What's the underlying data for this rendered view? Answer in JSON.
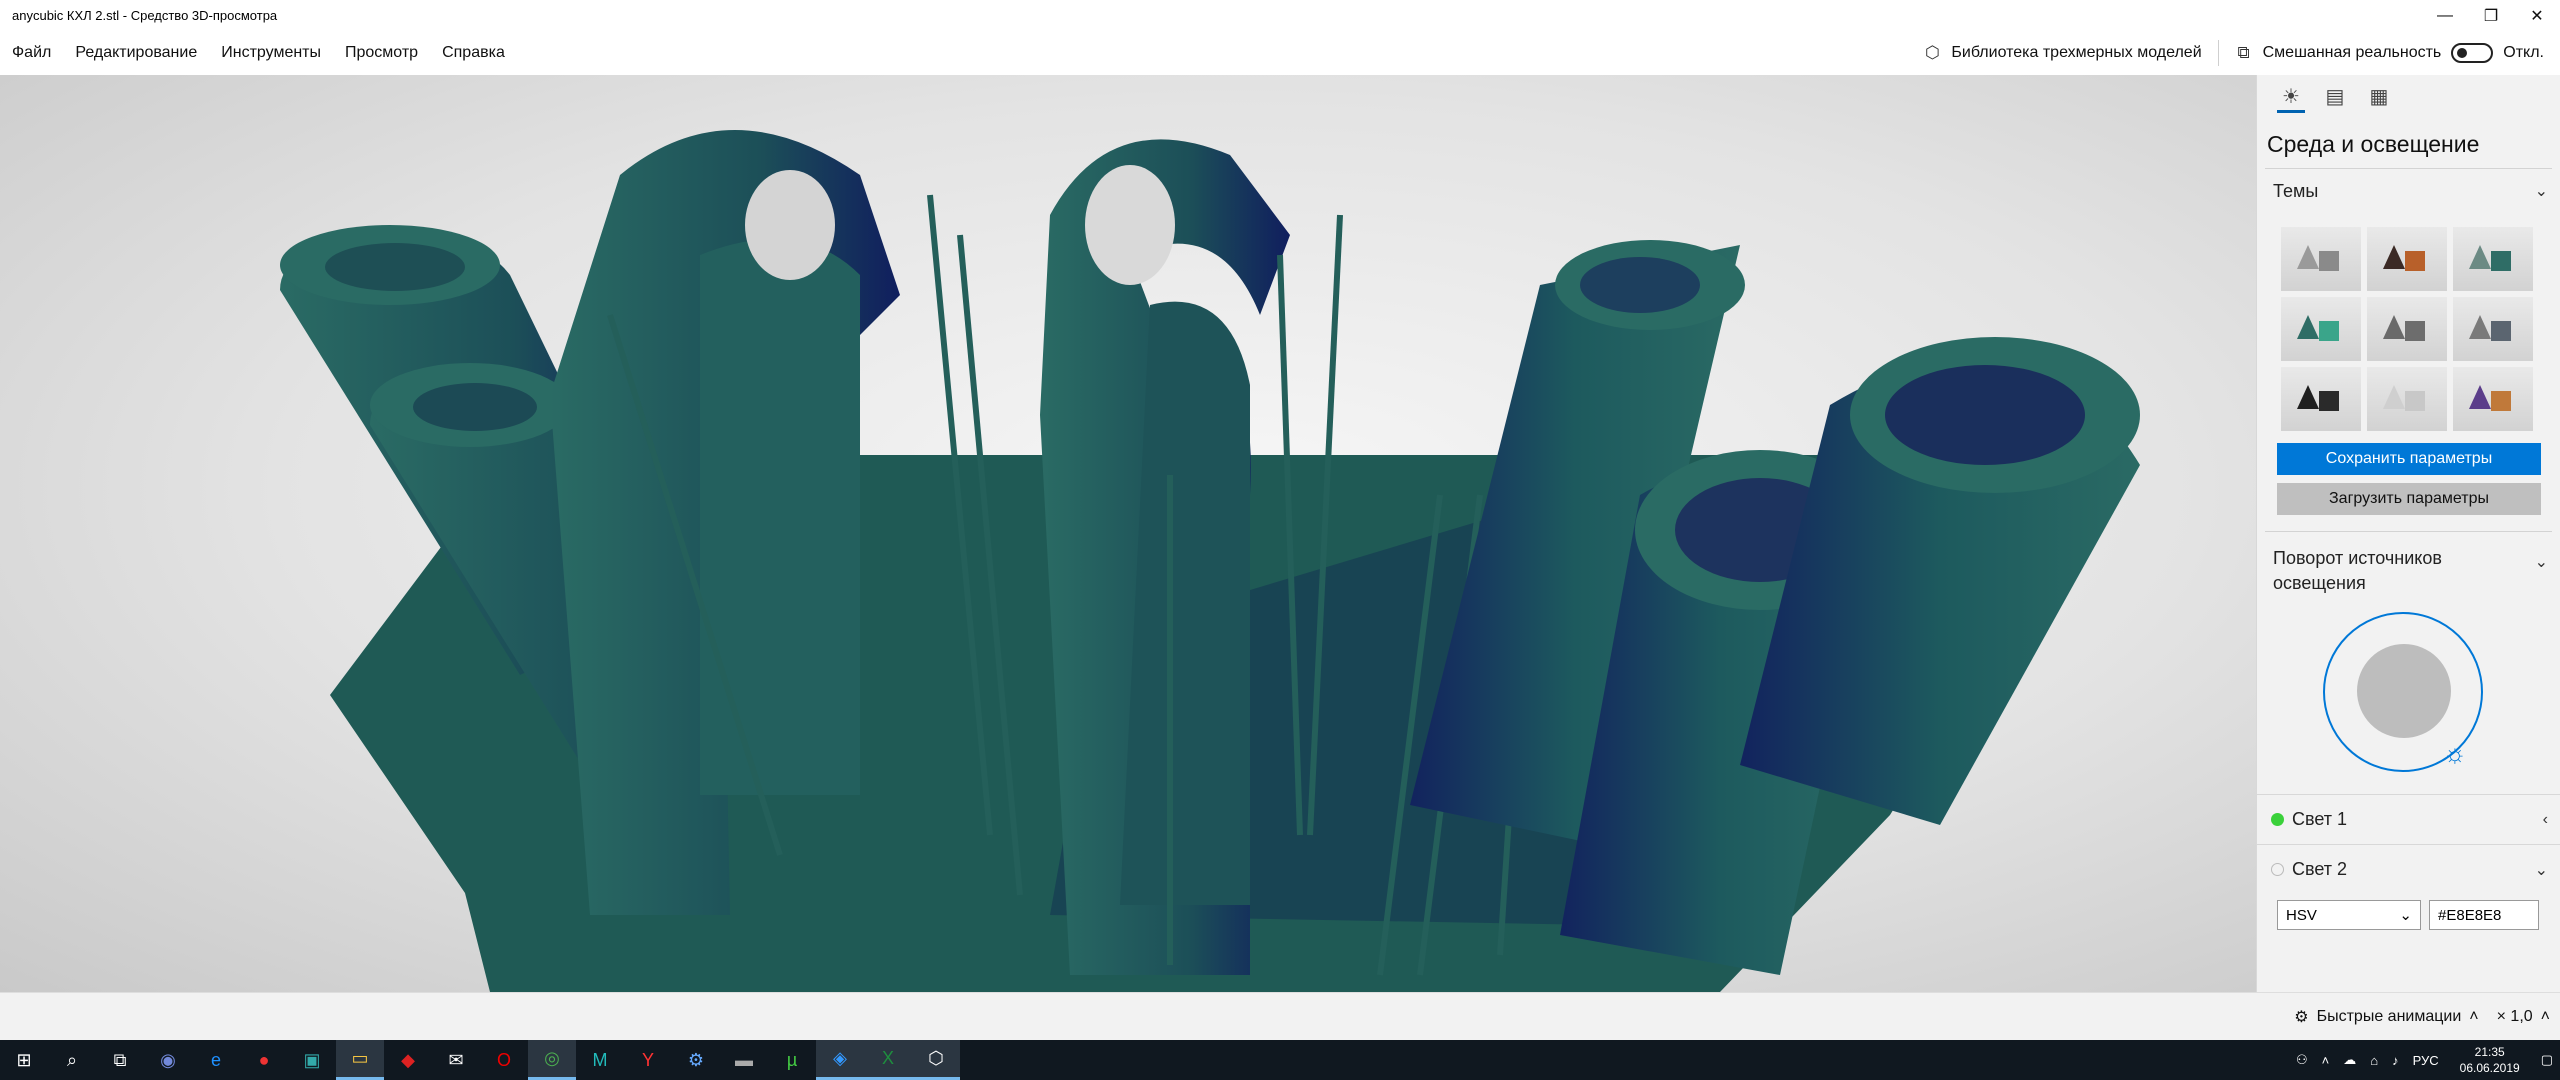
{
  "window": {
    "title": "anycubic КХЛ 2.stl - Средство 3D-просмотра",
    "controls": [
      "—",
      "❐",
      "✕"
    ]
  },
  "menu": {
    "items": [
      "Файл",
      "Редактирование",
      "Инструменты",
      "Просмотр",
      "Справка"
    ],
    "library_label": "Библиотека трехмерных моделей",
    "mixed_reality_label": "Смешанная реальность",
    "mixed_reality_state": "Откл."
  },
  "panel": {
    "title": "Среда и освещение",
    "themes_label": "Темы",
    "themes": [
      {
        "cone": "#9a9a9a",
        "cube": "#8a8a8a"
      },
      {
        "cone": "#3b2a25",
        "cube": "#b8602a"
      },
      {
        "cone": "#6b8a84",
        "cube": "#2f6d66"
      },
      {
        "cone": "#2f6d66",
        "cube": "#3aa58a"
      },
      {
        "cone": "#6a6a6a",
        "cube": "#6d6d6d"
      },
      {
        "cone": "#7a7a7a",
        "cube": "#5b6570"
      },
      {
        "cone": "#1f1f1f",
        "cube": "#2a2a2a"
      },
      {
        "cone": "#cfcfcf",
        "cube": "#c8c8c8"
      },
      {
        "cone": "#5b3d8a",
        "cube": "#c0793a"
      }
    ],
    "save_label": "Сохранить параметры",
    "load_label": "Загрузить параметры",
    "rotation_label": "Поворот источников освещения",
    "light1_label": "Свет 1",
    "light1_color": "#3ad13a",
    "light2_label": "Свет 2",
    "color_mode": "HSV",
    "hex_value": "#E8E8E8"
  },
  "status": {
    "animations_label": "Быстрые анимации",
    "zoom": "× 1,0"
  },
  "taskbar": {
    "time": "21:35",
    "date": "06.06.2019",
    "lang": "РУС"
  },
  "model": {
    "color": "#1f5c58",
    "shadow": "#0f1f5a"
  }
}
